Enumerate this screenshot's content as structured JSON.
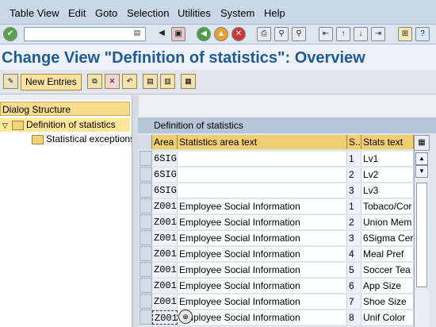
{
  "menu": {
    "items": [
      "Table View",
      "Edit",
      "Goto",
      "Selection",
      "Utilities",
      "System",
      "Help"
    ]
  },
  "toolbar": {
    "command_field_value": "",
    "icons": [
      "enter-icon",
      "back-icon",
      "save-icon",
      "exit-icon",
      "cancel-icon",
      "print-icon",
      "find-icon",
      "find-next-icon",
      "first-page-icon",
      "prev-page-icon",
      "next-page-icon",
      "last-page-icon",
      "create-session-icon",
      "help-icon"
    ]
  },
  "page": {
    "title": "Change View \"Definition of statistics\": Overview"
  },
  "app_toolbar": {
    "new_entries_label": "New Entries"
  },
  "dialog_structure": {
    "header": "Dialog Structure",
    "nodes": [
      {
        "label": "Definition of statistics"
      },
      {
        "label": "Statistical exceptions"
      }
    ]
  },
  "table": {
    "title": "Definition of statistics",
    "columns": [
      "Area",
      "Statistics area text",
      "S...",
      "Stats text"
    ],
    "rows": [
      {
        "area": "6SIG",
        "text": "",
        "s": "1",
        "stats": "Lv1"
      },
      {
        "area": "6SIG",
        "text": "",
        "s": "2",
        "stats": "Lv2"
      },
      {
        "area": "6SIG",
        "text": "",
        "s": "3",
        "stats": "Lv3"
      },
      {
        "area": "Z001",
        "text": "Employee Social  Information",
        "s": "1",
        "stats": "Tobaco/Cor"
      },
      {
        "area": "Z001",
        "text": "Employee Social  Information",
        "s": "2",
        "stats": "Union Mem"
      },
      {
        "area": "Z001",
        "text": "Employee Social  Information",
        "s": "3",
        "stats": "6Sigma Cer"
      },
      {
        "area": "Z001",
        "text": "Employee Social  Information",
        "s": "4",
        "stats": "Meal Pref"
      },
      {
        "area": "Z001",
        "text": "Employee Social  Information",
        "s": "5",
        "stats": "Soccer Tea"
      },
      {
        "area": "Z001",
        "text": "Employee Social  Information",
        "s": "6",
        "stats": "App Size"
      },
      {
        "area": "Z001",
        "text": "Employee Social  Information",
        "s": "7",
        "stats": "Shoe Size"
      },
      {
        "area": "Z001",
        "text": "Employee Social  Information",
        "s": "8",
        "stats": "Unif Color"
      }
    ]
  }
}
